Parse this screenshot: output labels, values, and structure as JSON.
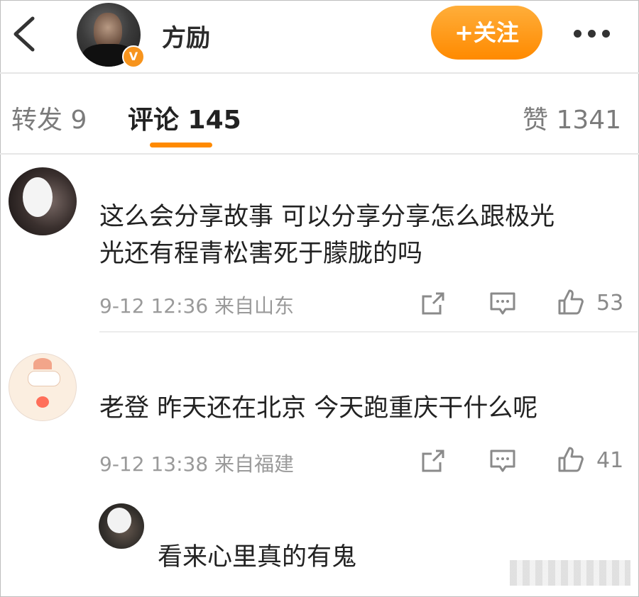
{
  "header": {
    "user_name": "方励",
    "verified_badge": "V",
    "follow_label": "+关注"
  },
  "tabs": {
    "repost": "转发 9",
    "comments": "评论 145",
    "likes": "赞 1341"
  },
  "comments": [
    {
      "text_line1": "这么会分享故事 可以分享分享怎么跟极光",
      "text_line2": "光还有程青松害死于朦胧的吗",
      "time_location": "9-12 12:36  来自山东",
      "likes": "53"
    },
    {
      "text": "老登 昨天还在北京 今天跑重庆干什么呢",
      "time_location": "9-12 13:38  来自福建",
      "likes": "41"
    }
  ],
  "reply": {
    "text": "看来心里真的有鬼"
  },
  "colors": {
    "accent": "#ff8a00",
    "badge": "#f7941d"
  }
}
